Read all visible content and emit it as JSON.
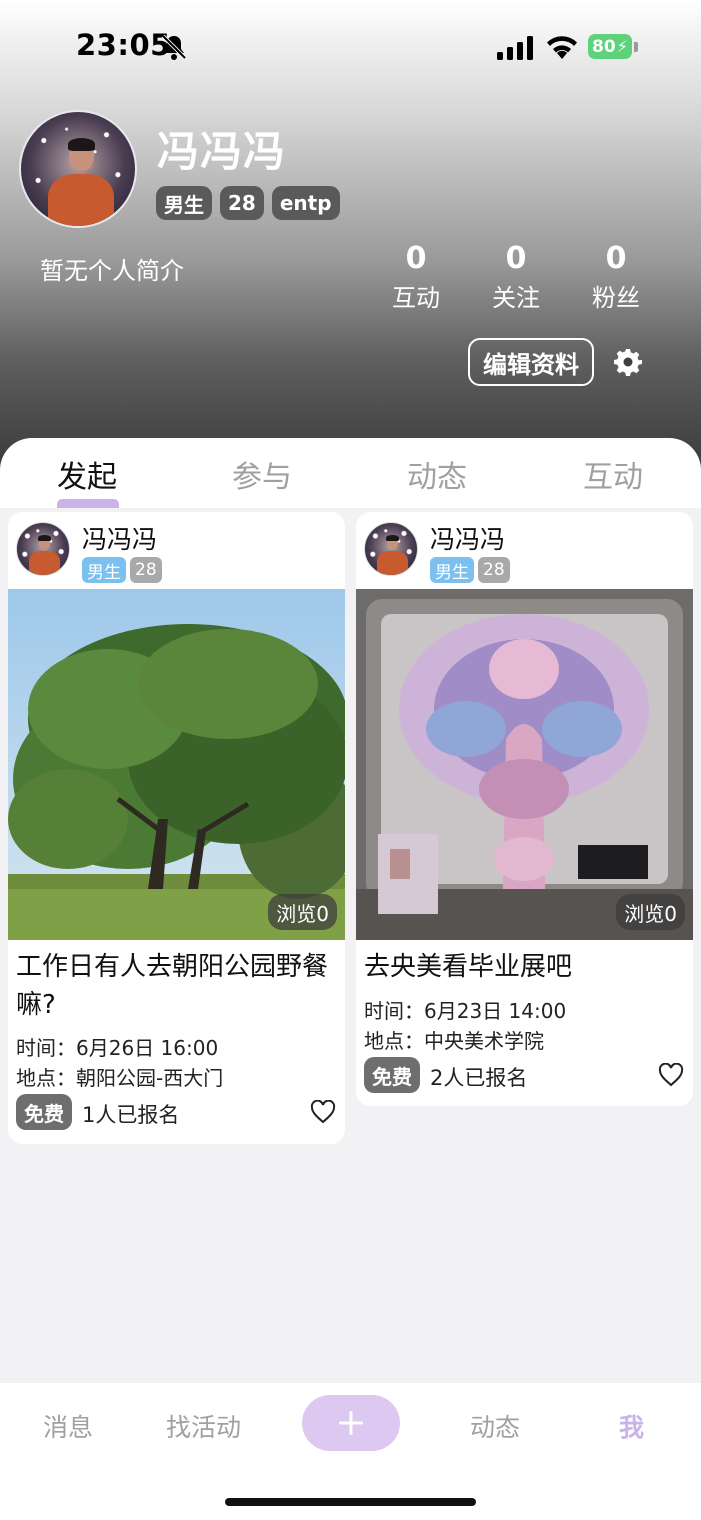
{
  "status_bar": {
    "time": "23:05",
    "battery": "80"
  },
  "profile": {
    "name": "冯冯冯",
    "tags": [
      "男生",
      "28",
      "entp"
    ],
    "bio": "暂无个人简介",
    "stats": [
      {
        "value": "0",
        "label": "互动"
      },
      {
        "value": "0",
        "label": "关注"
      },
      {
        "value": "0",
        "label": "粉丝"
      }
    ],
    "edit_label": "编辑资料"
  },
  "tabs": [
    "发起",
    "参与",
    "动态",
    "互动"
  ],
  "active_tab": "发起",
  "cards": [
    {
      "author": "冯冯冯",
      "gender": "男生",
      "age": "28",
      "views": "浏览0",
      "title": "工作日有人去朝阳公园野餐嘛?",
      "time": "时间：6月26日 16:00",
      "place": "地点：朝阳公园-西大门",
      "price": "免费",
      "signups": "1人已报名"
    },
    {
      "author": "冯冯冯",
      "gender": "男生",
      "age": "28",
      "views": "浏览0",
      "title": "去央美看毕业展吧",
      "time": "时间：6月23日 14:00",
      "place": "地点：中央美术学院",
      "price": "免费",
      "signups": "2人已报名"
    }
  ],
  "bottom_nav": {
    "items": [
      "消息",
      "找活动",
      "动态",
      "我"
    ],
    "add_label": "+",
    "active": "我"
  },
  "colors": {
    "accent": "#c9b3e8",
    "gender_tag": "#7cc0ef"
  }
}
